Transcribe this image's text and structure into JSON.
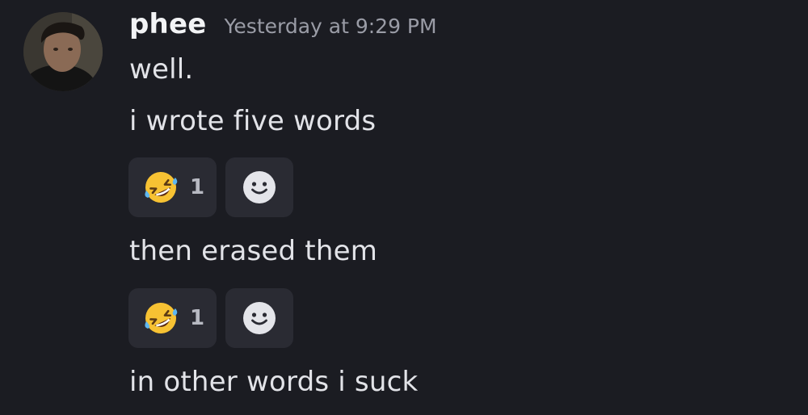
{
  "message": {
    "username": "phee",
    "timestamp": "Yesterday at 9:29 PM",
    "lines": [
      "well.",
      "i wrote five words",
      "then erased them",
      "in other words i suck"
    ]
  },
  "reactions": [
    {
      "emoji_icon": "rolling-on-floor-laughing-emoji",
      "count": "1"
    },
    {
      "emoji_icon": "rolling-on-floor-laughing-emoji",
      "count": "1"
    }
  ],
  "icons": {
    "add_reaction": "smiley-face-icon",
    "avatar": "user-avatar"
  },
  "colors": {
    "background": "#1b1c22",
    "reaction_bg": "#2a2b33",
    "timestamp": "#9a9ca6"
  }
}
